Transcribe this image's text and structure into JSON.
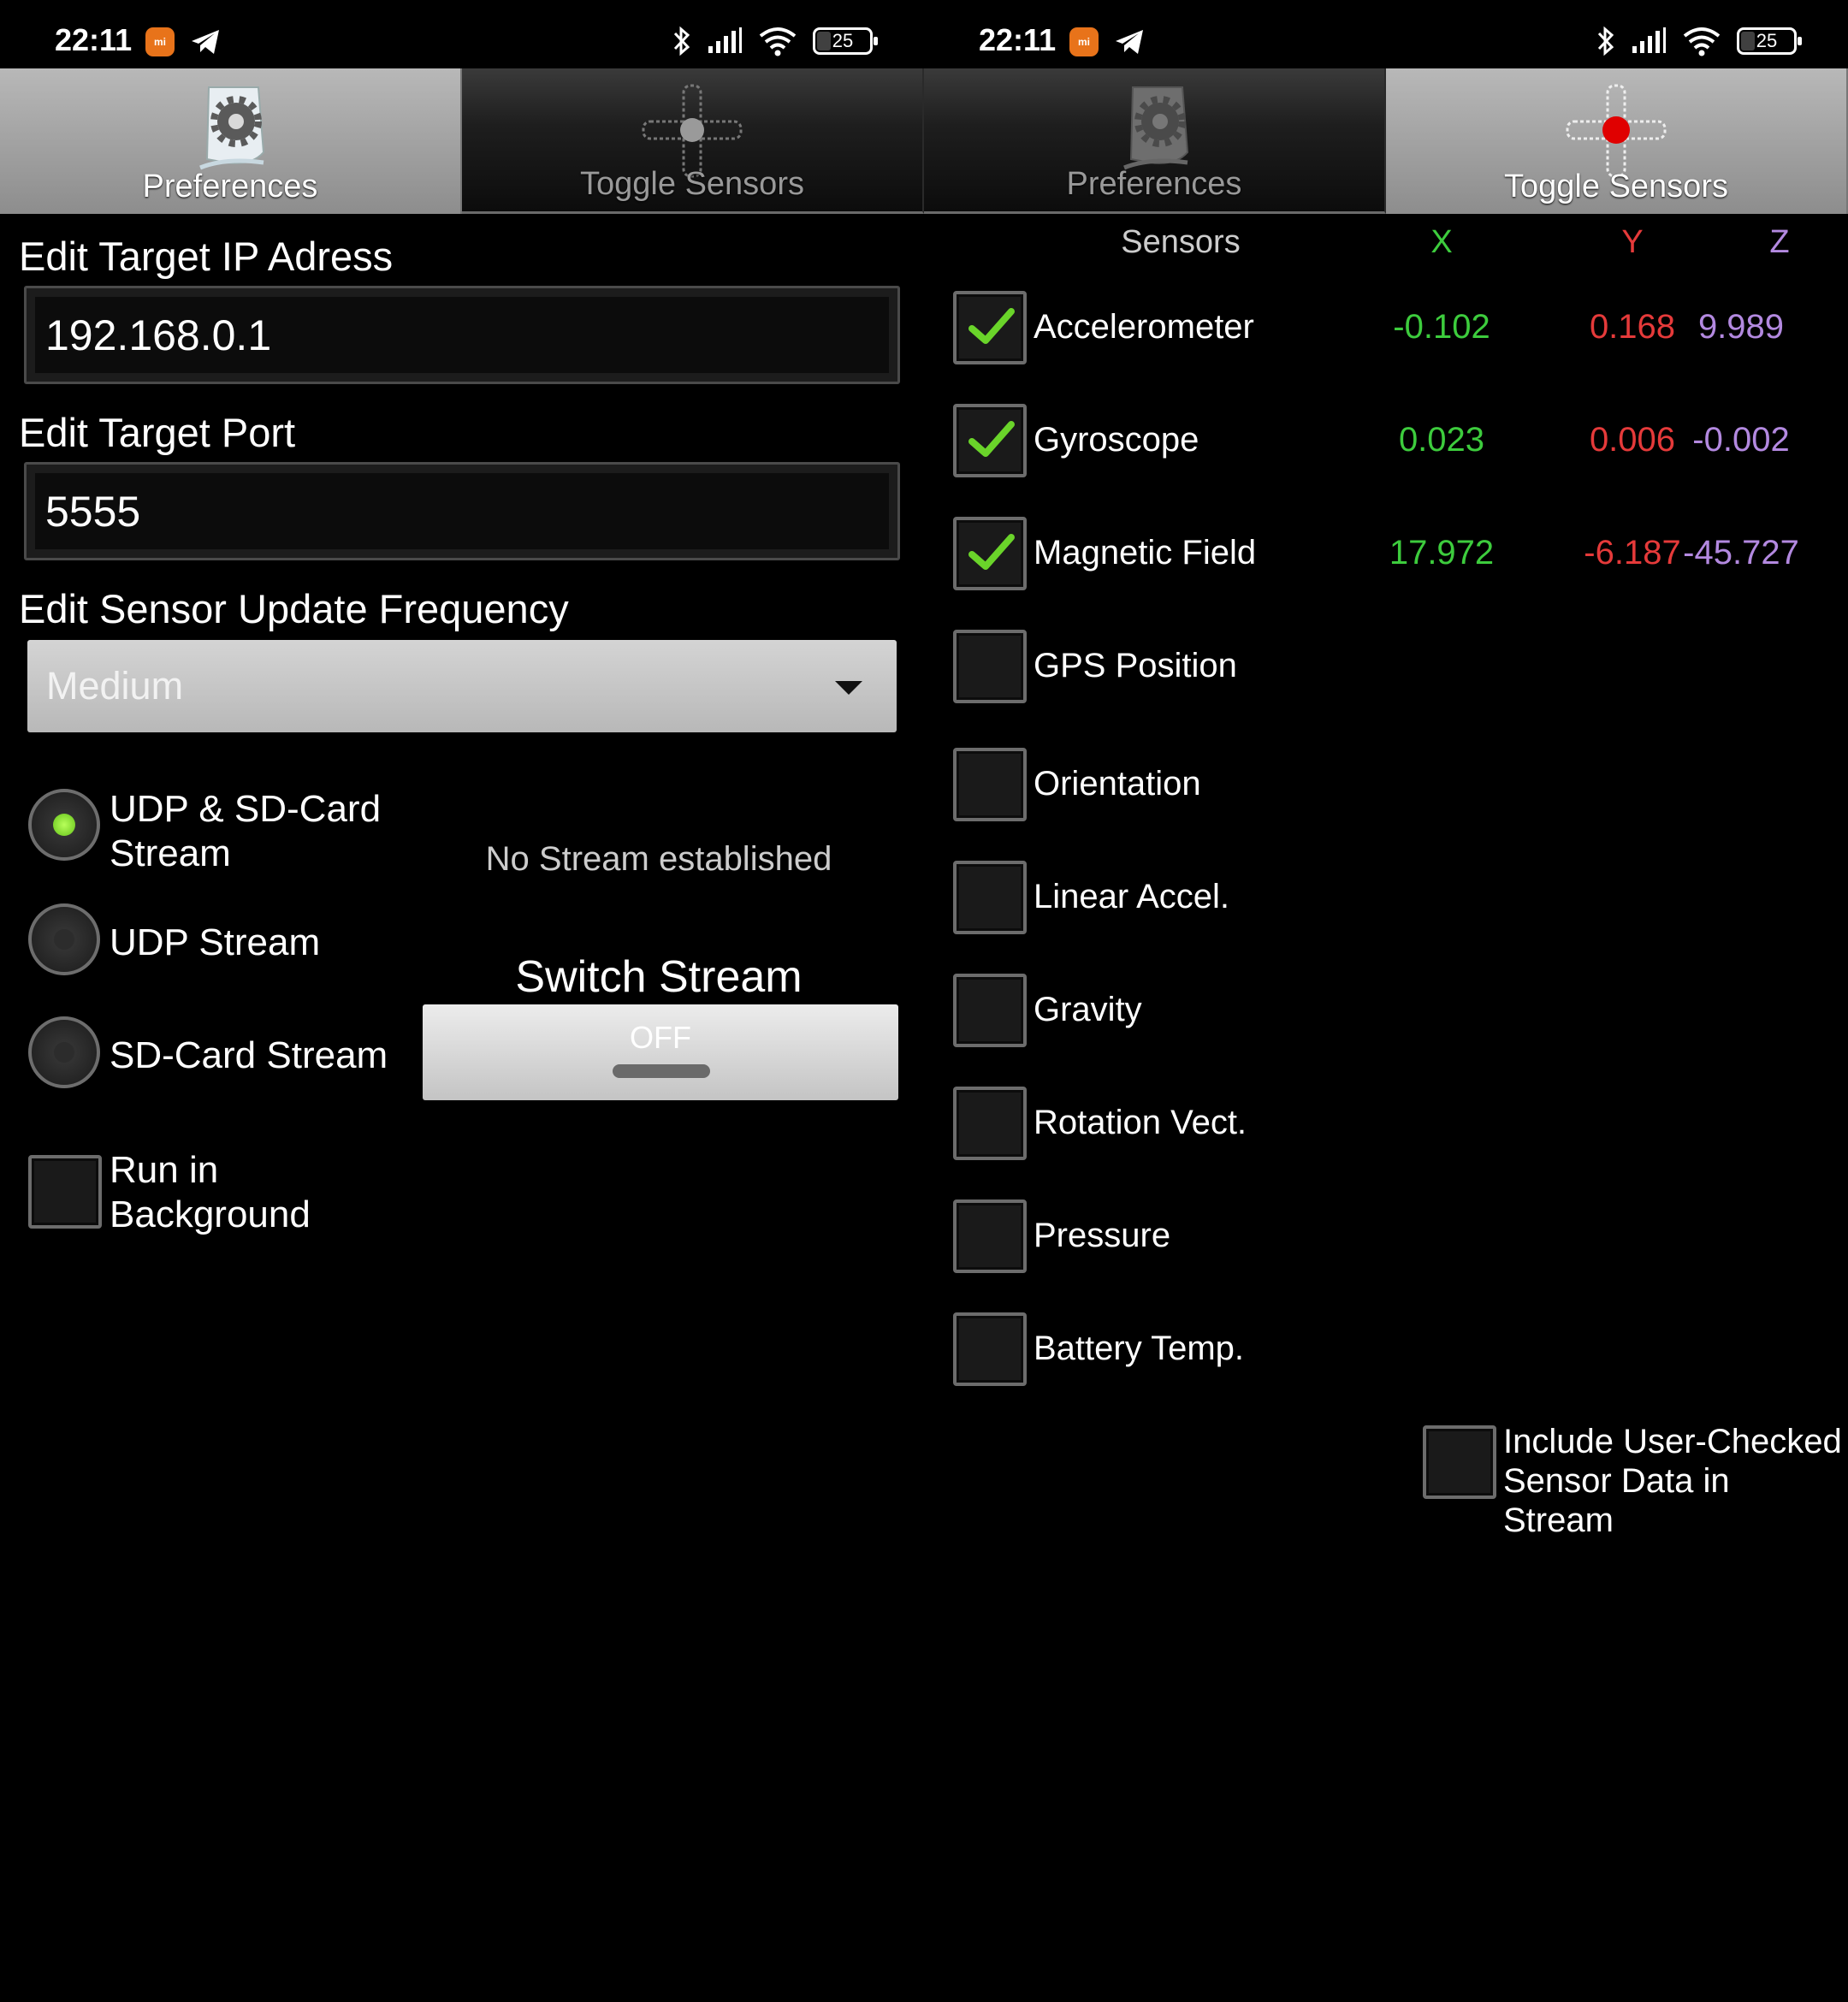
{
  "status_bar": {
    "time": "22:11",
    "battery": "25"
  },
  "tabs": {
    "preferences": "Preferences",
    "toggle_sensors": "Toggle Sensors"
  },
  "preferences": {
    "ip_label": "Edit Target IP Adress",
    "ip_value": "192.168.0.1",
    "port_label": "Edit Target Port",
    "port_value": "5555",
    "freq_label": "Edit Sensor Update Frequency",
    "freq_value": "Medium",
    "stream_options": [
      {
        "label_line1": "UDP & SD-Card",
        "label_line2": "Stream",
        "selected": true
      },
      {
        "label": "UDP Stream",
        "selected": false
      },
      {
        "label": "SD-Card Stream",
        "selected": false
      }
    ],
    "stream_status": "No Stream established",
    "switch_title": "Switch Stream",
    "switch_state": "OFF",
    "run_bg_line1": "Run in",
    "run_bg_line2": "Background",
    "run_bg_checked": false
  },
  "sensors": {
    "headers": {
      "name": "Sensors",
      "x": "X",
      "y": "Y",
      "z": "Z"
    },
    "colors": {
      "x": "#3dcc3d",
      "y": "#e53a3a",
      "z": "#b389e0"
    },
    "items": [
      {
        "name": "Accelerometer",
        "checked": true,
        "x": "-0.102",
        "y": "0.168",
        "z": "9.989"
      },
      {
        "name": "Gyroscope",
        "checked": true,
        "x": "0.023",
        "y": "0.006",
        "z": "-0.002"
      },
      {
        "name": "Magnetic Field",
        "checked": true,
        "x": "17.972",
        "y": "-6.187",
        "z": "-45.727"
      },
      {
        "name": "GPS Position",
        "checked": false
      },
      {
        "name": "Orientation",
        "checked": false
      },
      {
        "name": "Linear Accel.",
        "checked": false
      },
      {
        "name": "Gravity",
        "checked": false
      },
      {
        "name": "Rotation Vect.",
        "checked": false
      },
      {
        "name": "Pressure",
        "checked": false
      },
      {
        "name": "Battery Temp.",
        "checked": false
      }
    ],
    "include_line1": "Include User-Checked",
    "include_line2": "Sensor Data in Stream",
    "include_checked": false
  }
}
